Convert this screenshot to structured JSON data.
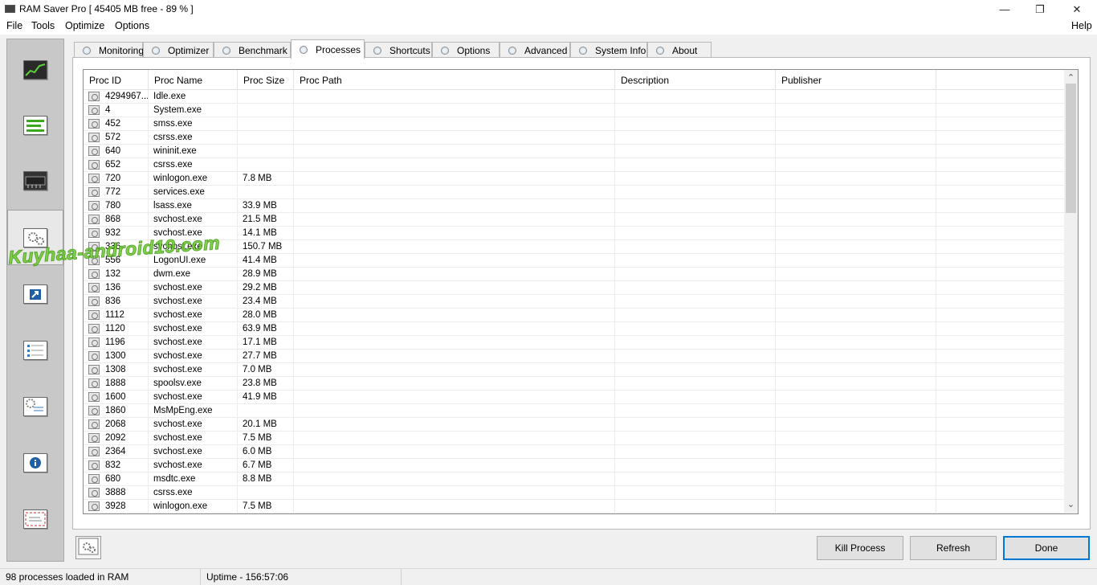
{
  "window": {
    "title": "RAM Saver Pro [ 45405 MB free - 89 % ]",
    "minimize_glyph": "—",
    "maximize_glyph": "❐",
    "close_glyph": "✕"
  },
  "menu": {
    "items": [
      "File",
      "Tools",
      "Optimize",
      "Options"
    ],
    "help": "Help"
  },
  "sidebar": {
    "icons": [
      "monitoring-chart-icon",
      "optimizer-bars-icon",
      "benchmark-chip-icon",
      "processes-gears-icon",
      "shortcuts-arrow-icon",
      "options-checklist-icon",
      "advanced-gear-list-icon",
      "system-info-icon",
      "about-envelope-icon"
    ],
    "active_index": 3
  },
  "tabs": [
    "Monitoring",
    "Optimizer",
    "Benchmark",
    "Processes",
    "Shortcuts",
    "Options",
    "Advanced",
    "System Info",
    "About"
  ],
  "active_tab": "Processes",
  "table": {
    "columns": [
      "Proc ID",
      "Proc Name",
      "Proc Size",
      "Proc Path",
      "Description",
      "Publisher"
    ],
    "rows": [
      [
        "4294967...",
        "Idle.exe",
        ""
      ],
      [
        "4",
        "System.exe",
        ""
      ],
      [
        "452",
        "smss.exe",
        ""
      ],
      [
        "572",
        "csrss.exe",
        ""
      ],
      [
        "640",
        "wininit.exe",
        ""
      ],
      [
        "652",
        "csrss.exe",
        ""
      ],
      [
        "720",
        "winlogon.exe",
        "7.8 MB"
      ],
      [
        "772",
        "services.exe",
        ""
      ],
      [
        "780",
        "lsass.exe",
        "33.9 MB"
      ],
      [
        "868",
        "svchost.exe",
        "21.5 MB"
      ],
      [
        "932",
        "svchost.exe",
        "14.1 MB"
      ],
      [
        "336",
        "svchost.exe",
        "150.7 MB"
      ],
      [
        "556",
        "LogonUI.exe",
        "41.4 MB"
      ],
      [
        "132",
        "dwm.exe",
        "28.9 MB"
      ],
      [
        "136",
        "svchost.exe",
        "29.2 MB"
      ],
      [
        "836",
        "svchost.exe",
        "23.4 MB"
      ],
      [
        "1112",
        "svchost.exe",
        "28.0 MB"
      ],
      [
        "1120",
        "svchost.exe",
        "63.9 MB"
      ],
      [
        "1196",
        "svchost.exe",
        "17.1 MB"
      ],
      [
        "1300",
        "svchost.exe",
        "27.7 MB"
      ],
      [
        "1308",
        "svchost.exe",
        "7.0 MB"
      ],
      [
        "1888",
        "spoolsv.exe",
        "23.8 MB"
      ],
      [
        "1600",
        "svchost.exe",
        "41.9 MB"
      ],
      [
        "1860",
        "MsMpEng.exe",
        ""
      ],
      [
        "2068",
        "svchost.exe",
        "20.1 MB"
      ],
      [
        "2092",
        "svchost.exe",
        "7.5 MB"
      ],
      [
        "2364",
        "svchost.exe",
        "6.0 MB"
      ],
      [
        "832",
        "svchost.exe",
        "6.7 MB"
      ],
      [
        "680",
        "msdtc.exe",
        "8.8 MB"
      ],
      [
        "3888",
        "csrss.exe",
        ""
      ],
      [
        "3928",
        "winlogon.exe",
        "7.5 MB"
      ]
    ],
    "scroll_up_glyph": "⌃",
    "scroll_down_glyph": "⌄"
  },
  "buttons": {
    "kill": "Kill Process",
    "refresh": "Refresh",
    "done": "Done"
  },
  "status": {
    "processes": "98 processes loaded in RAM",
    "uptime": "Uptime - 156:57:06"
  },
  "watermark": "Kuyhaa-android19.com",
  "colors": {
    "accent": "#0078d7",
    "watermark": "#6ecb2c",
    "sidebar_bg": "#c8c8c8"
  }
}
